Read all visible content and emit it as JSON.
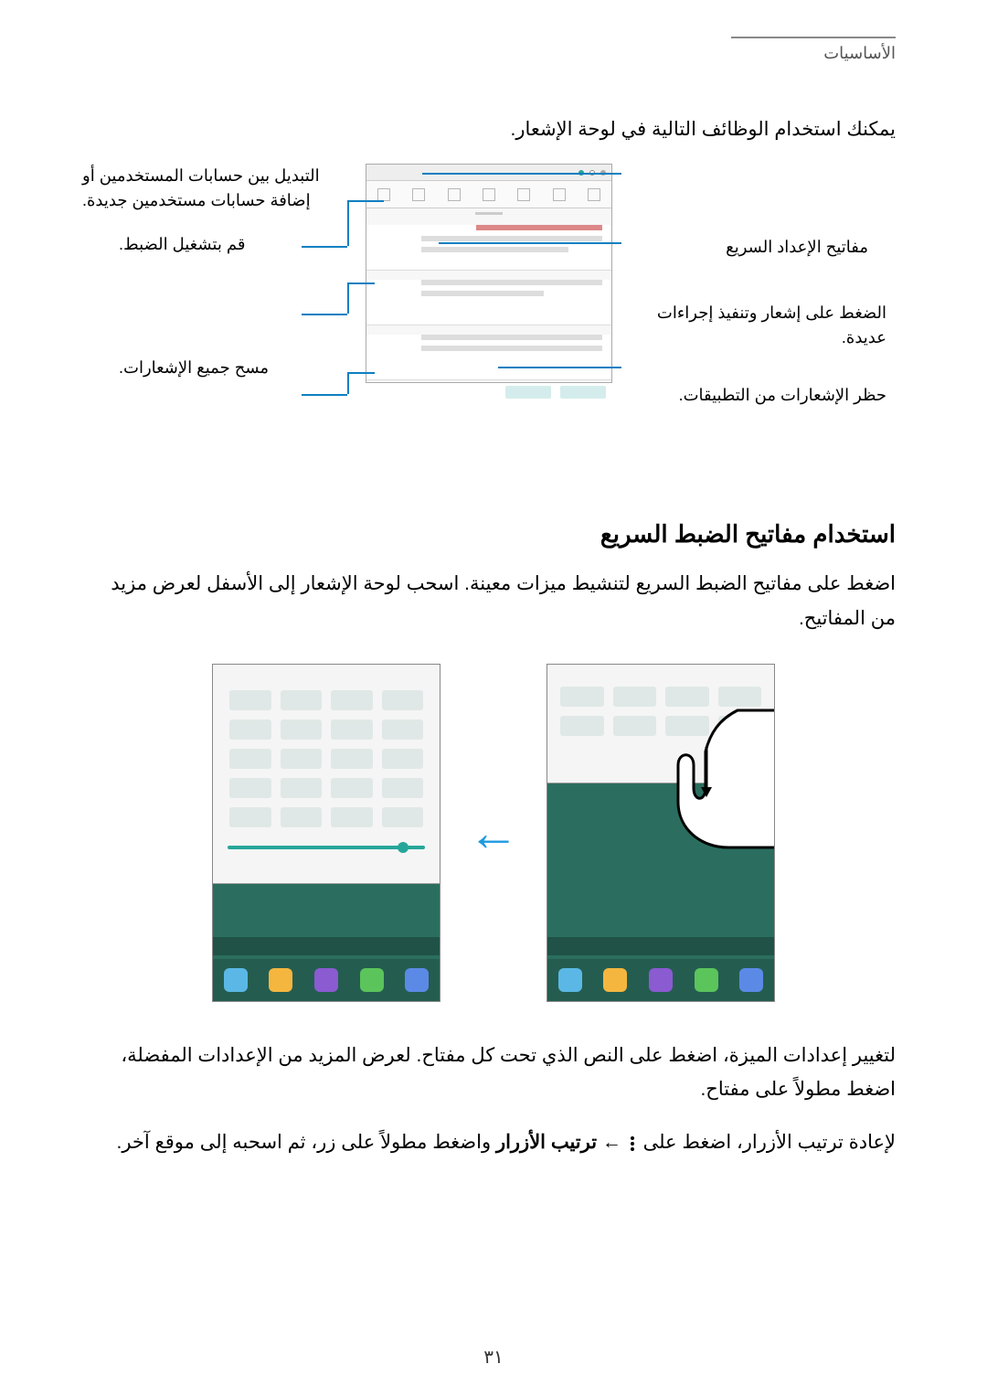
{
  "header": {
    "section_title": "الأساسيات"
  },
  "intro": "يمكنك استخدام الوظائف التالية في لوحة الإشعار.",
  "callouts": {
    "users": "التبديل بين حسابات المستخدمين أو إضافة حسابات مستخدمين جديدة.",
    "settings": "قم بتشغيل الضبط.",
    "clear": "مسح جميع الإشعارات.",
    "quick": "مفاتيح الإعداد السريع",
    "press": "الضغط على إشعار وتنفيذ إجراءات عديدة.",
    "block": "حظر الإشعارات من التطبيقات."
  },
  "section_title": "استخدام مفاتيح الضبط السريع",
  "body1": "اضغط على مفاتيح الضبط السريع لتنشيط ميزات معينة. اسحب لوحة الإشعار إلى الأسفل لعرض مزيد من المفاتيح.",
  "body2_pre": "لتغيير إعدادات الميزة، اضغط على النص الذي تحت كل مفتاح. لعرض المزيد من الإعدادات المفضلة، اضغط مطولاً على مفتاح.",
  "body3_a": "لإعادة ترتيب الأزرار، اضغط على ",
  "body3_b": " ← ",
  "body3_bold": "ترتيب الأزرار",
  "body3_c": " واضغط مطولاً على زر، ثم اسحبه إلى موقع آخر.",
  "page_number": "٣١"
}
